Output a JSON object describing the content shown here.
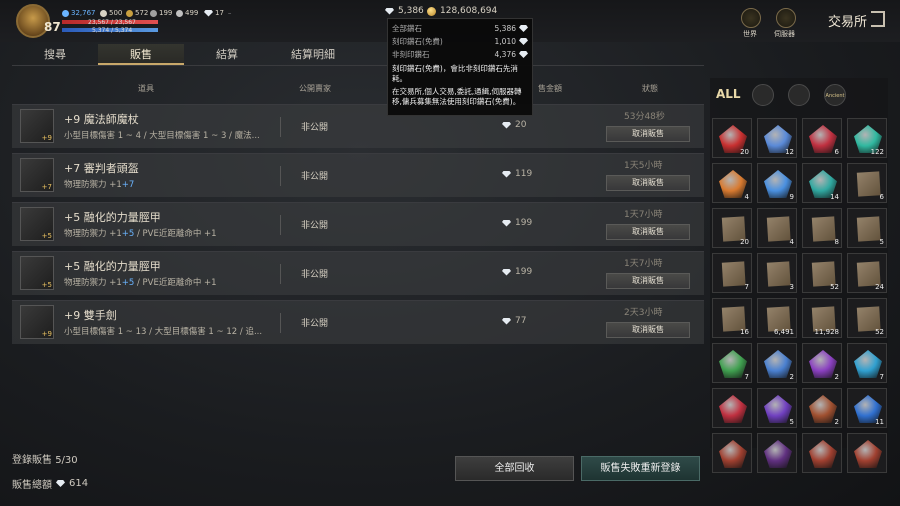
{
  "player": {
    "level": "87",
    "hp": "23,567 / 23,567",
    "mp": "5,374 / 5,374",
    "hp_pct": 1.0,
    "mp_pct": 1.0
  },
  "stats": [
    {
      "icon": "blue-icon",
      "value": "32,767",
      "color": "#6ab4ff"
    },
    {
      "icon": "gem-icon",
      "value": "500",
      "color": "#e8e2d4"
    },
    {
      "icon": "gold-icon",
      "value": "572",
      "color": "#e8e2d4"
    },
    {
      "icon": "target-icon",
      "value": "199",
      "color": "#e8e2d4"
    },
    {
      "icon": "person-icon",
      "value": "499",
      "color": "#e8e2d4"
    },
    {
      "icon": "diamond-icon",
      "value": "17",
      "color": "#e8e2d4"
    }
  ],
  "currency": {
    "diamonds": "5,386",
    "gold": "128,608,694"
  },
  "top_right": {
    "world": "世界",
    "server": "伺服器",
    "title": "交易所"
  },
  "tabs": [
    "搜尋",
    "販售",
    "結算",
    "結算明細"
  ],
  "columns": {
    "item": "道具",
    "public": "公開賣家",
    "price": "售金額",
    "status": "狀態"
  },
  "tooltip": {
    "rows": [
      {
        "label": "全部鑽石",
        "value": "5,386"
      },
      {
        "label": "刻印鑽石(免費)",
        "value": "1,010"
      },
      {
        "label": "非刻印鑽石",
        "value": "4,376"
      }
    ],
    "text1": "刻印鑽石(免費)，會比非刻印鑽石先消耗。",
    "text2": "在交易所,個人交易,委託,通緝,伺服器轉移,傭兵募集無法使用刻印鑽石(免費)。"
  },
  "listings": [
    {
      "enh": "+9",
      "name": "+9 魔法師魔杖",
      "desc": "小型目標傷害 1 ~ 4 / 大型目標傷害 1 ~ 3 / 魔法...",
      "public": "非公開",
      "price": "20",
      "time": "53分48秒",
      "cancel": "取消販售"
    },
    {
      "enh": "+7",
      "name": "+7 審判者頭盔",
      "desc_a": "物理防禦力 +1",
      "desc_b": "+7",
      "public": "非公開",
      "price": "119",
      "time": "1天5小時",
      "cancel": "取消販售"
    },
    {
      "enh": "+5",
      "name": "+5 融化的力量脛甲",
      "desc_a": "物理防禦力 +1",
      "desc_b": "+5",
      "desc_c": " / PVE近距離命中 +1",
      "public": "非公開",
      "price": "199",
      "time": "1天7小時",
      "cancel": "取消販售"
    },
    {
      "enh": "+5",
      "name": "+5 融化的力量脛甲",
      "desc_a": "物理防禦力 +1",
      "desc_b": "+5",
      "desc_c": " / PVE近距離命中 +1",
      "public": "非公開",
      "price": "199",
      "time": "1天7小時",
      "cancel": "取消販售"
    },
    {
      "enh": "+9",
      "name": "+9 雙手劍",
      "desc": "小型目標傷害 1 ~ 13 / 大型目標傷害 1 ~ 12 / 追...",
      "public": "非公開",
      "price": "77",
      "time": "2天3小時",
      "cancel": "取消販售"
    }
  ],
  "filters": [
    "ALL",
    "helmet-icon",
    "bag-icon",
    "ancient-icon"
  ],
  "filter_labels": {
    "ancient": "Ancient"
  },
  "inventory": [
    {
      "icon": "red-crystal-icon",
      "count": "20",
      "color": "#c83030"
    },
    {
      "icon": "blue-crystal-icon",
      "count": "12",
      "color": "#5a8ad8"
    },
    {
      "icon": "red-gem-icon",
      "count": "6",
      "color": "#c03040"
    },
    {
      "icon": "teal-orb-icon",
      "count": "122",
      "color": "#30b8a0"
    },
    {
      "icon": "orange-orb-icon",
      "count": "4",
      "color": "#d87a30"
    },
    {
      "icon": "blue-orb-icon",
      "count": "9",
      "color": "#4a90e0"
    },
    {
      "icon": "teal-orb-icon",
      "count": "14",
      "color": "#30a8a0"
    },
    {
      "icon": "scroll-icon",
      "count": "6",
      "color": "#9a8870"
    },
    {
      "icon": "scroll-icon",
      "count": "20",
      "color": "#9a8870"
    },
    {
      "icon": "scroll-icon",
      "count": "4",
      "color": "#9a8870"
    },
    {
      "icon": "scroll-icon",
      "count": "8",
      "color": "#9a8870"
    },
    {
      "icon": "scroll-icon",
      "count": "5",
      "color": "#9a8870"
    },
    {
      "icon": "scroll-icon",
      "count": "7",
      "color": "#9a8870"
    },
    {
      "icon": "scroll-icon",
      "count": "3",
      "color": "#9a8870"
    },
    {
      "icon": "scroll-icon",
      "count": "52",
      "color": "#9a8870"
    },
    {
      "icon": "scroll-icon",
      "count": "24",
      "color": "#9a8870"
    },
    {
      "icon": "scroll-icon",
      "count": "16",
      "color": "#9a8870"
    },
    {
      "icon": "scroll-icon",
      "count": "6,491",
      "color": "#9a8870"
    },
    {
      "icon": "scroll-icon",
      "count": "11,928",
      "color": "#9a8870"
    },
    {
      "icon": "scroll-icon",
      "count": "52",
      "color": "#9a8870"
    },
    {
      "icon": "green-crystal-icon",
      "count": "7",
      "color": "#40a050"
    },
    {
      "icon": "blue-crystal-icon",
      "count": "2",
      "color": "#4a80d0"
    },
    {
      "icon": "purple-gem-icon",
      "count": "2",
      "color": "#8a40c0"
    },
    {
      "icon": "cyan-gem-icon",
      "count": "7",
      "color": "#30a0d0"
    },
    {
      "icon": "red-gem-icon",
      "count": "",
      "color": "#c03040"
    },
    {
      "icon": "purple-gem-icon",
      "count": "5",
      "color": "#7040c0"
    },
    {
      "icon": "copper-gem-icon",
      "count": "2",
      "color": "#a05030"
    },
    {
      "icon": "blue-gem-icon",
      "count": "11",
      "color": "#3070d0"
    },
    {
      "icon": "red-item-icon",
      "count": "",
      "color": "#a04030"
    },
    {
      "icon": "purple-item-icon",
      "count": "",
      "color": "#603080"
    },
    {
      "icon": "red-item-icon",
      "count": "",
      "color": "#a04030"
    },
    {
      "icon": "red-item-icon",
      "count": "",
      "color": "#a04030"
    }
  ],
  "bottom": {
    "reg_label": "登錄販售",
    "reg_count": "5/30",
    "total_label": "販售總額",
    "total": "614"
  },
  "buttons": {
    "recall": "全部回收",
    "reregister": "販售失敗重新登錄"
  }
}
